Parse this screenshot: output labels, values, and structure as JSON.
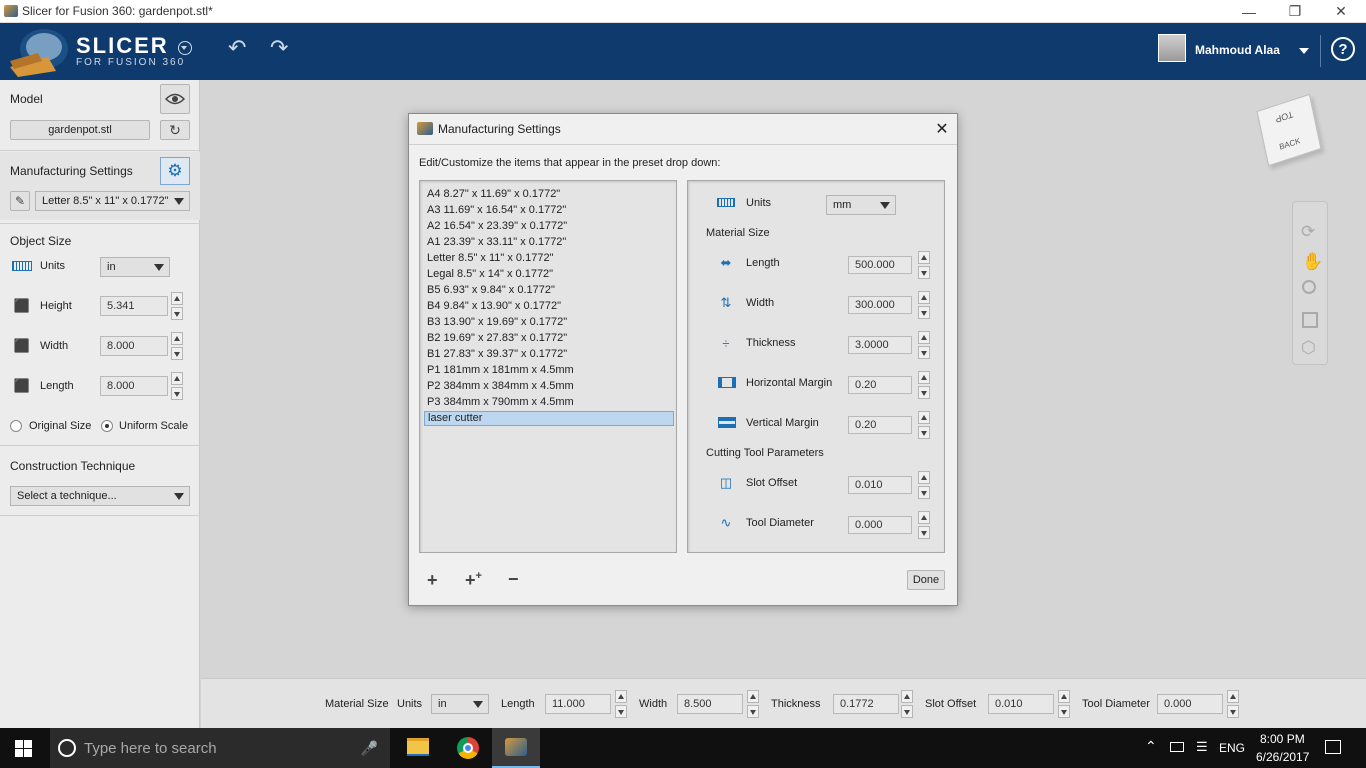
{
  "window": {
    "title": "Slicer for Fusion 360: gardenpot.stl*"
  },
  "header": {
    "logo_text": "SLICER",
    "logo_sub": "FOR FUSION 360",
    "user_name": "Mahmoud Alaa",
    "help": "?"
  },
  "left_panel": {
    "model_label": "Model",
    "model_file": "gardenpot.stl",
    "manufacturing_label": "Manufacturing Settings",
    "preset_value": "Letter 8.5\" x 11\" x 0.1772\"",
    "object_size_label": "Object Size",
    "units_label": "Units",
    "units_value": "in",
    "height_label": "Height",
    "height_value": "5.341",
    "width_label": "Width",
    "width_value": "8.000",
    "length_label": "Length",
    "length_value": "8.000",
    "original_size_label": "Original Size",
    "uniform_scale_label": "Uniform Scale",
    "construction_label": "Construction Technique",
    "technique_placeholder": "Select a technique..."
  },
  "viewcube": {
    "top": "TOP",
    "back": "BACK"
  },
  "dialog": {
    "title": "Manufacturing Settings",
    "instruction": "Edit/Customize the items that appear in the preset drop down:",
    "presets": [
      "A4 8.27\" x 11.69\" x 0.1772\"",
      "A3 11.69\" x 16.54\" x 0.1772\"",
      "A2 16.54\" x 23.39\" x 0.1772\"",
      "A1 23.39\" x 33.11\" x 0.1772\"",
      "Letter 8.5\" x 11\" x 0.1772\"",
      "Legal 8.5\" x 14\" x 0.1772\"",
      "B5 6.93\" x 9.84\" x 0.1772\"",
      "B4 9.84\" x 13.90\" x 0.1772\"",
      "B3 13.90\" x 19.69\" x 0.1772\"",
      "B2 19.69\" x 27.83\" x 0.1772\"",
      "B1 27.83\" x 39.37\" x 0.1772\"",
      "P1 181mm x 181mm x 4.5mm",
      "P2 384mm x 384mm x 4.5mm",
      "P3 384mm x 790mm x 4.5mm",
      "laser cutter"
    ],
    "selected_index": 14,
    "units_label": "Units",
    "units_value": "mm",
    "material_size_label": "Material Size",
    "length_label": "Length",
    "length_value": "500.000",
    "width_label": "Width",
    "width_value": "300.000",
    "thickness_label": "Thickness",
    "thickness_value": "3.0000",
    "hmargin_label": "Horizontal Margin",
    "hmargin_value": "0.20",
    "vmargin_label": "Vertical Margin",
    "vmargin_value": "0.20",
    "cutting_label": "Cutting Tool Parameters",
    "slot_label": "Slot Offset",
    "slot_value": "0.010",
    "tool_label": "Tool Diameter",
    "tool_value": "0.000",
    "done_label": "Done"
  },
  "bottom_bar": {
    "material_size_label": "Material Size",
    "units_label": "Units",
    "units_value": "in",
    "length_label": "Length",
    "length_value": "11.000",
    "width_label": "Width",
    "width_value": "8.500",
    "thickness_label": "Thickness",
    "thickness_value": "0.1772",
    "slot_label": "Slot Offset",
    "slot_value": "0.010",
    "tool_label": "Tool Diameter",
    "tool_value": "0.000"
  },
  "taskbar": {
    "search_placeholder": "Type here to search",
    "lang": "ENG",
    "time": "8:00 PM",
    "date": "6/26/2017"
  }
}
